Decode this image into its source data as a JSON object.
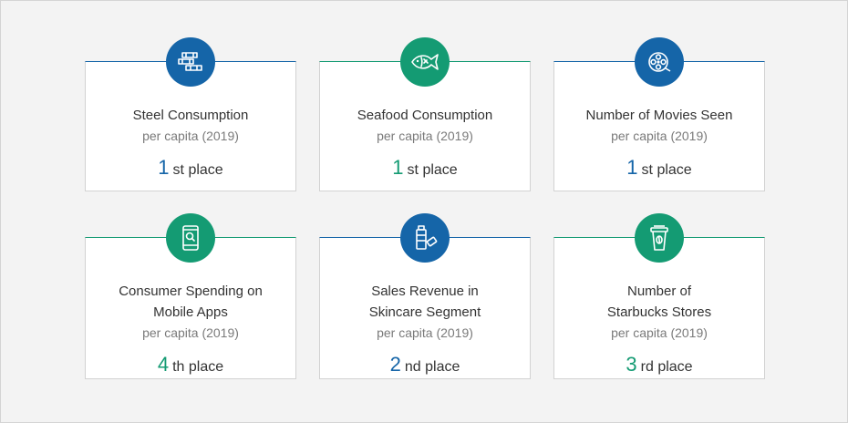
{
  "colors": {
    "blue": "#1565a8",
    "green": "#149b73"
  },
  "cards": [
    {
      "icon": "steel-beams-icon",
      "color": "blue",
      "title_lines": [
        "Steel Consumption"
      ],
      "subtitle": "per capita (2019)",
      "rank": "1",
      "suffix": "st place"
    },
    {
      "icon": "fish-icon",
      "color": "green",
      "title_lines": [
        "Seafood Consumption"
      ],
      "subtitle": "per capita (2019)",
      "rank": "1",
      "suffix": "st place"
    },
    {
      "icon": "film-reel-icon",
      "color": "blue",
      "title_lines": [
        "Number of Movies Seen"
      ],
      "subtitle": "per capita (2019)",
      "rank": "1",
      "suffix": "st place"
    },
    {
      "icon": "mobile-app-icon",
      "color": "green",
      "title_lines": [
        "Consumer Spending on",
        "Mobile Apps"
      ],
      "subtitle": "per capita (2019)",
      "rank": "4",
      "suffix": "th place"
    },
    {
      "icon": "skincare-products-icon",
      "color": "blue",
      "title_lines": [
        "Sales Revenue in",
        "Skincare Segment"
      ],
      "subtitle": "per capita (2019)",
      "rank": "2",
      "suffix": "nd place"
    },
    {
      "icon": "coffee-cup-icon",
      "color": "green",
      "title_lines": [
        "Number of",
        "Starbucks Stores"
      ],
      "subtitle": "per capita (2019)",
      "rank": "3",
      "suffix": "rd place"
    }
  ]
}
